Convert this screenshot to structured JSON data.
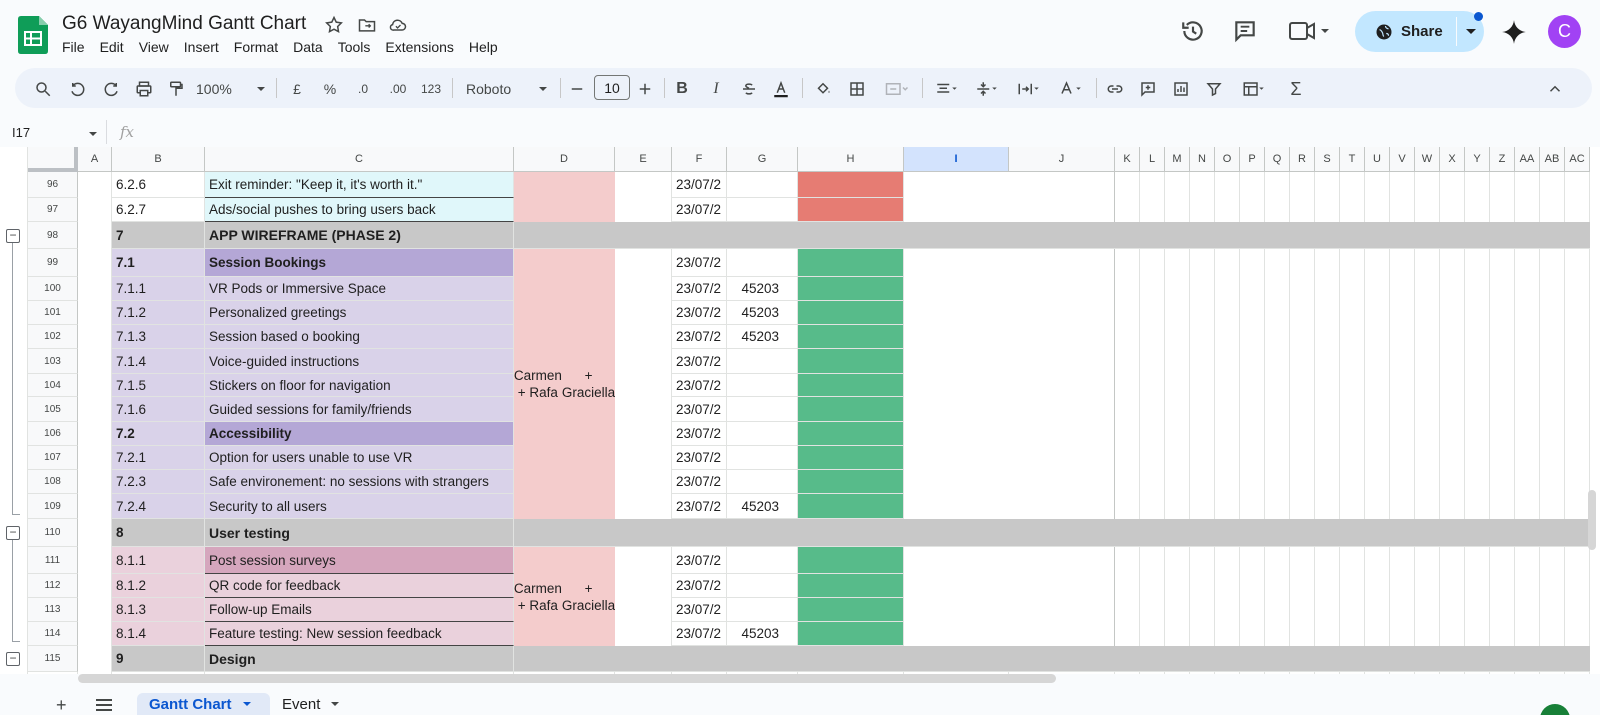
{
  "doc": {
    "title": "G6 WayangMind Gantt Chart"
  },
  "menu": [
    "File",
    "Edit",
    "View",
    "Insert",
    "Format",
    "Data",
    "Tools",
    "Extensions",
    "Help"
  ],
  "share": {
    "label": "Share"
  },
  "avatar": {
    "initial": "C",
    "color": "#a142f4"
  },
  "toolbar": {
    "zoom": "100%",
    "currency": "£",
    "percent": "%",
    "dec_less": ".0",
    "dec_more": ".00",
    "number_format": "123",
    "font": "Roboto",
    "font_size": "10"
  },
  "formula": {
    "cell_ref": "I17",
    "fx": "fx"
  },
  "columns": [
    "A",
    "B",
    "C",
    "D",
    "E",
    "F",
    "G",
    "H",
    "I",
    "J",
    "K",
    "L",
    "M",
    "N",
    "O",
    "P",
    "Q",
    "R",
    "S",
    "T",
    "U",
    "V",
    "W",
    "X",
    "Y",
    "Z",
    "AA",
    "AB",
    "AC"
  ],
  "colors": {
    "section": "#c8c8c8",
    "lavender": "#d9d2e9",
    "lavender_header": "#b4a7d6",
    "pink": "#ead1dc",
    "pink_header": "#d5a6bd",
    "salmon": "#f4cccc",
    "teal": "#e0f7fa",
    "red": "#e67c73",
    "green": "#57bb8a",
    "selected_col": "#d3e3fd"
  },
  "rows": [
    {
      "n": "96",
      "b": "6.2.6",
      "c": "Exit reminder: \"Keep it, it's worth it.\"",
      "f": "23/07/2",
      "g": ""
    },
    {
      "n": "97",
      "b": "6.2.7",
      "c": "Ads/social pushes to bring users back",
      "f": "23/07/2",
      "g": ""
    },
    {
      "n": "98",
      "b": "7",
      "c": "APP WIREFRAME (PHASE 2)",
      "f": "",
      "g": ""
    },
    {
      "n": "99",
      "b": "7.1",
      "c": "Session Bookings",
      "f": "23/07/2",
      "g": ""
    },
    {
      "n": "100",
      "b": "7.1.1",
      "c": "VR Pods or Immersive Space",
      "f": "23/07/2",
      "g": "45203"
    },
    {
      "n": "101",
      "b": "7.1.2",
      "c": "Personalized greetings",
      "f": "23/07/2",
      "g": "45203"
    },
    {
      "n": "102",
      "b": "7.1.3",
      "c": "Session based o booking",
      "f": "23/07/2",
      "g": "45203"
    },
    {
      "n": "103",
      "b": "7.1.4",
      "c": "Voice-guided instructions",
      "f": "23/07/2",
      "g": ""
    },
    {
      "n": "104",
      "b": "7.1.5",
      "c": "Stickers on floor for navigation",
      "f": "23/07/2",
      "g": ""
    },
    {
      "n": "105",
      "b": "7.1.6",
      "c": "Guided sessions for family/friends",
      "f": "23/07/2",
      "g": ""
    },
    {
      "n": "106",
      "b": "7.2",
      "c": "Accessibility",
      "f": "23/07/2",
      "g": ""
    },
    {
      "n": "107",
      "b": "7.2.1",
      "c": "Option for users unable to use VR",
      "f": "23/07/2",
      "g": ""
    },
    {
      "n": "108",
      "b": "7.2.3",
      "c": "Safe environement: no sessions with strangers",
      "f": "23/07/2",
      "g": ""
    },
    {
      "n": "109",
      "b": "7.2.4",
      "c": "Security to all users",
      "f": "23/07/2",
      "g": "45203"
    },
    {
      "n": "110",
      "b": "8",
      "c": "User testing",
      "f": "",
      "g": ""
    },
    {
      "n": "111",
      "b": "8.1.1",
      "c": "Post session surveys",
      "f": "23/07/2",
      "g": ""
    },
    {
      "n": "112",
      "b": "8.1.2",
      "c": "QR code for feedback",
      "f": "23/07/2",
      "g": ""
    },
    {
      "n": "113",
      "b": "8.1.3",
      "c": "Follow-up Emails",
      "f": "23/07/2",
      "g": ""
    },
    {
      "n": "114",
      "b": "8.1.4",
      "c": "Feature testing: New session feedback",
      "f": "23/07/2",
      "g": "45203"
    },
    {
      "n": "115",
      "b": "9",
      "c": "Design",
      "f": "",
      "g": ""
    }
  ],
  "assignee_1": {
    "line1": "Carmen + Rafa",
    "line2": "+ Graciella"
  },
  "assignee_2": {
    "line1": "Carmen + Rafa",
    "line2": "+ Graciella"
  },
  "sheets": {
    "active": "Gantt Chart",
    "other": "Event"
  }
}
